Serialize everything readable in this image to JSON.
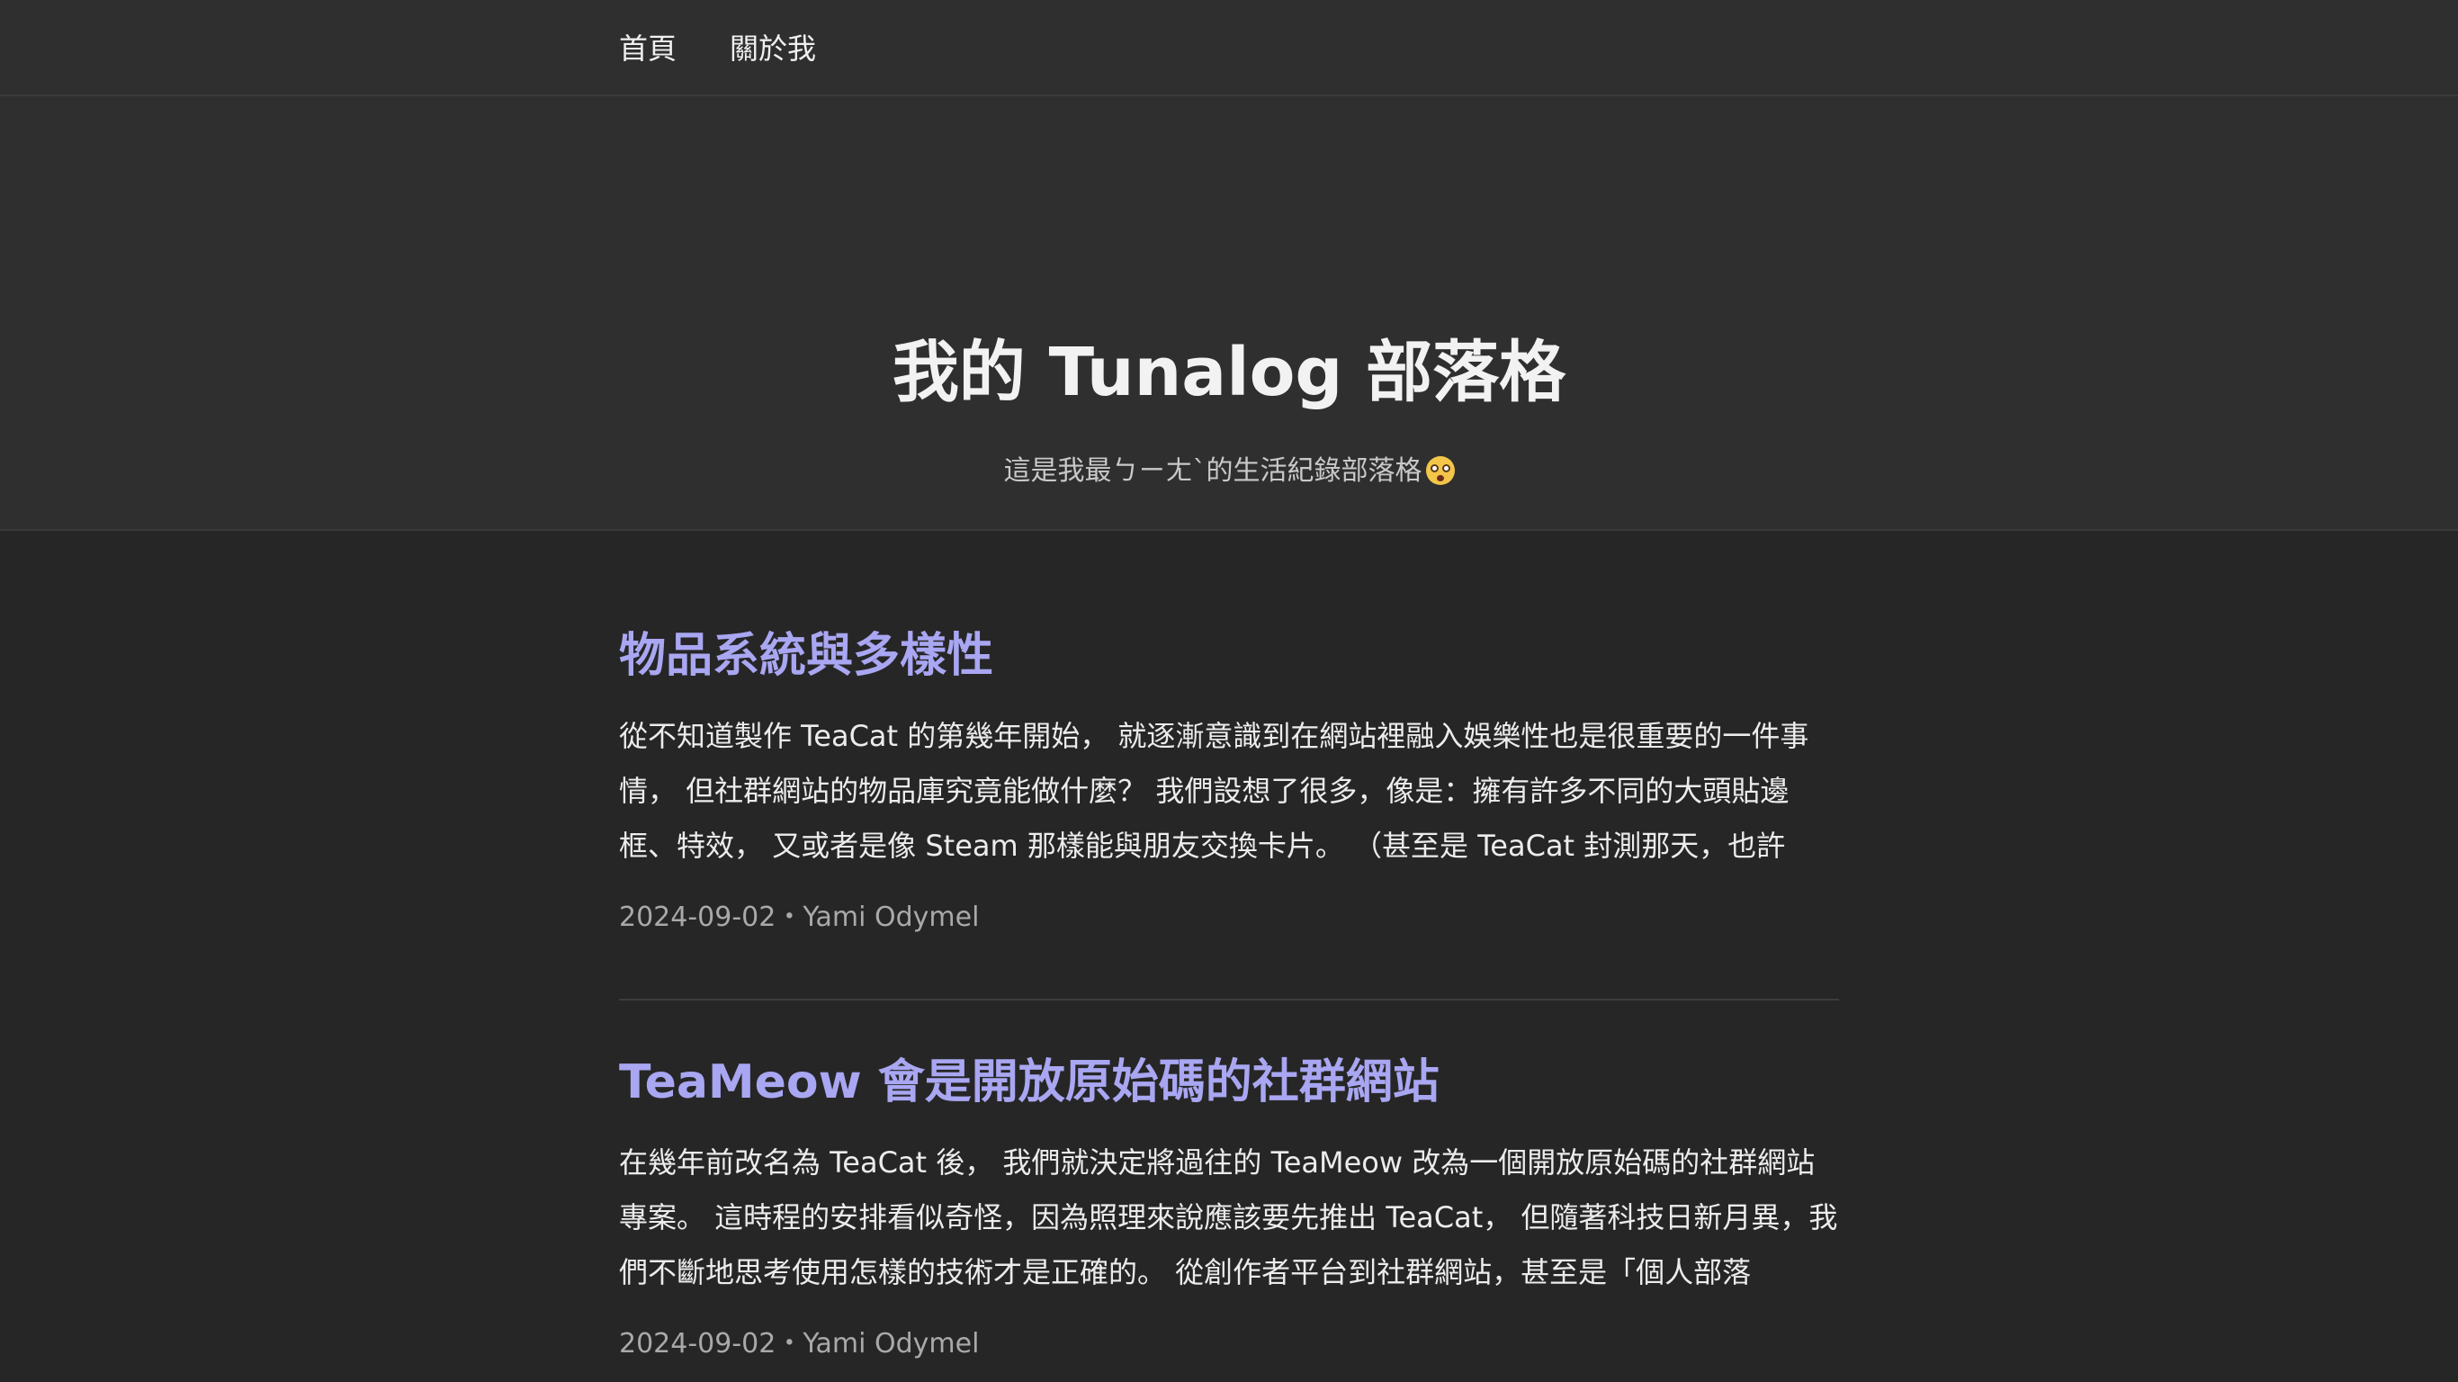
{
  "nav": {
    "items": [
      {
        "label": "首頁"
      },
      {
        "label": "關於我"
      }
    ]
  },
  "hero": {
    "title": "我的 Tunalog 部落格",
    "subtitle": "這是我最ㄅㄧㄤˋ的生活紀錄部落格",
    "emoji_icon": "flushed-face-icon"
  },
  "posts": [
    {
      "title": "物品系統與多樣性",
      "excerpt": "從不知道製作 TeaCat 的第幾年開始， 就逐漸意識到在網站裡融入娛樂性也是很重要的一件事情， 但社群網站的物品庫究竟能做什麼？ 我們設想了很多，像是：擁有許多不同的大頭貼邊框、特效， 又或者是像 Steam 那樣能與朋友交換卡片。 （甚至是 TeaCat 封測那天，也許你…",
      "meta": "2024-09-02・Yami Odymel"
    },
    {
      "title": "TeaMeow 會是開放原始碼的社群網站",
      "excerpt": "在幾年前改名為 TeaCat 後， 我們就決定將過往的 TeaMeow 改為一個開放原始碼的社群網站專案。 這時程的安排看似奇怪，因為照理來說應該要先推出 TeaCat， 但隨著科技日新月異，我們不斷地思考使用怎樣的技術才是正確的。 從創作者平台到社群網站，甚至是「個人部落格」，…",
      "meta": "2024-09-02・Yami Odymel"
    }
  ],
  "colors": {
    "background": "#262626",
    "header_background": "#2f2f2f",
    "post_title": "#a9a6f2",
    "meta_text": "#a9a9a9"
  }
}
